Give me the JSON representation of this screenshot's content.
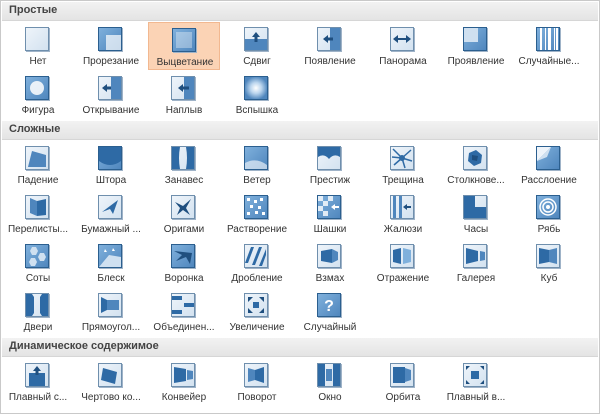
{
  "sections": [
    {
      "title": "Простые",
      "items": [
        {
          "label": "Нет",
          "icon": "none-icon"
        },
        {
          "label": "Прорезание",
          "icon": "cut-icon"
        },
        {
          "label": "Выцветание",
          "icon": "fade-icon",
          "selected": true
        },
        {
          "label": "Сдвиг",
          "icon": "push-icon"
        },
        {
          "label": "Появление",
          "icon": "wipe-icon"
        },
        {
          "label": "Панорама",
          "icon": "split-icon"
        },
        {
          "label": "Проявление",
          "icon": "reveal-icon"
        },
        {
          "label": "Случайные...",
          "icon": "random-bars-icon"
        },
        {
          "label": "Фигура",
          "icon": "shape-icon"
        },
        {
          "label": "Открывание",
          "icon": "uncover-icon"
        },
        {
          "label": "Наплыв",
          "icon": "cover-icon"
        },
        {
          "label": "Вспышка",
          "icon": "flash-icon"
        }
      ]
    },
    {
      "title": "Сложные",
      "items": [
        {
          "label": "Падение",
          "icon": "fall-over-icon"
        },
        {
          "label": "Штора",
          "icon": "drape-icon"
        },
        {
          "label": "Занавес",
          "icon": "curtains-icon"
        },
        {
          "label": "Ветер",
          "icon": "wind-icon"
        },
        {
          "label": "Престиж",
          "icon": "prestige-icon"
        },
        {
          "label": "Трещина",
          "icon": "fracture-icon"
        },
        {
          "label": "Столкнове...",
          "icon": "crush-icon"
        },
        {
          "label": "Расслоение",
          "icon": "peel-off-icon"
        },
        {
          "label": "Перелисты...",
          "icon": "page-curl-icon"
        },
        {
          "label": "Бумажный ...",
          "icon": "airplane-icon"
        },
        {
          "label": "Оригами",
          "icon": "origami-icon"
        },
        {
          "label": "Растворение",
          "icon": "dissolve-icon"
        },
        {
          "label": "Шашки",
          "icon": "checkerboard-icon"
        },
        {
          "label": "Жалюзи",
          "icon": "blinds-icon"
        },
        {
          "label": "Часы",
          "icon": "clock-icon"
        },
        {
          "label": "Рябь",
          "icon": "ripple-icon"
        },
        {
          "label": "Соты",
          "icon": "honeycomb-icon"
        },
        {
          "label": "Блеск",
          "icon": "glitter-icon"
        },
        {
          "label": "Воронка",
          "icon": "vortex-icon"
        },
        {
          "label": "Дробление",
          "icon": "shred-icon"
        },
        {
          "label": "Взмах",
          "icon": "switch-icon"
        },
        {
          "label": "Отражение",
          "icon": "flip-icon"
        },
        {
          "label": "Галерея",
          "icon": "gallery-icon"
        },
        {
          "label": "Куб",
          "icon": "cube-icon"
        },
        {
          "label": "Двери",
          "icon": "doors-icon"
        },
        {
          "label": "Прямоугол...",
          "icon": "box-icon"
        },
        {
          "label": "Объединен...",
          "icon": "comb-icon"
        },
        {
          "label": "Увеличение",
          "icon": "zoom-icon"
        },
        {
          "label": "Случайный",
          "icon": "random-icon"
        }
      ]
    },
    {
      "title": "Динамическое содержимое",
      "items": [
        {
          "label": "Плавный с...",
          "icon": "pan-icon"
        },
        {
          "label": "Чертово ко...",
          "icon": "ferris-wheel-icon"
        },
        {
          "label": "Конвейер",
          "icon": "conveyor-icon"
        },
        {
          "label": "Поворот",
          "icon": "rotate-icon"
        },
        {
          "label": "Окно",
          "icon": "window-icon"
        },
        {
          "label": "Орбита",
          "icon": "orbit-icon"
        },
        {
          "label": "Плавный в...",
          "icon": "fly-through-icon"
        }
      ]
    }
  ]
}
